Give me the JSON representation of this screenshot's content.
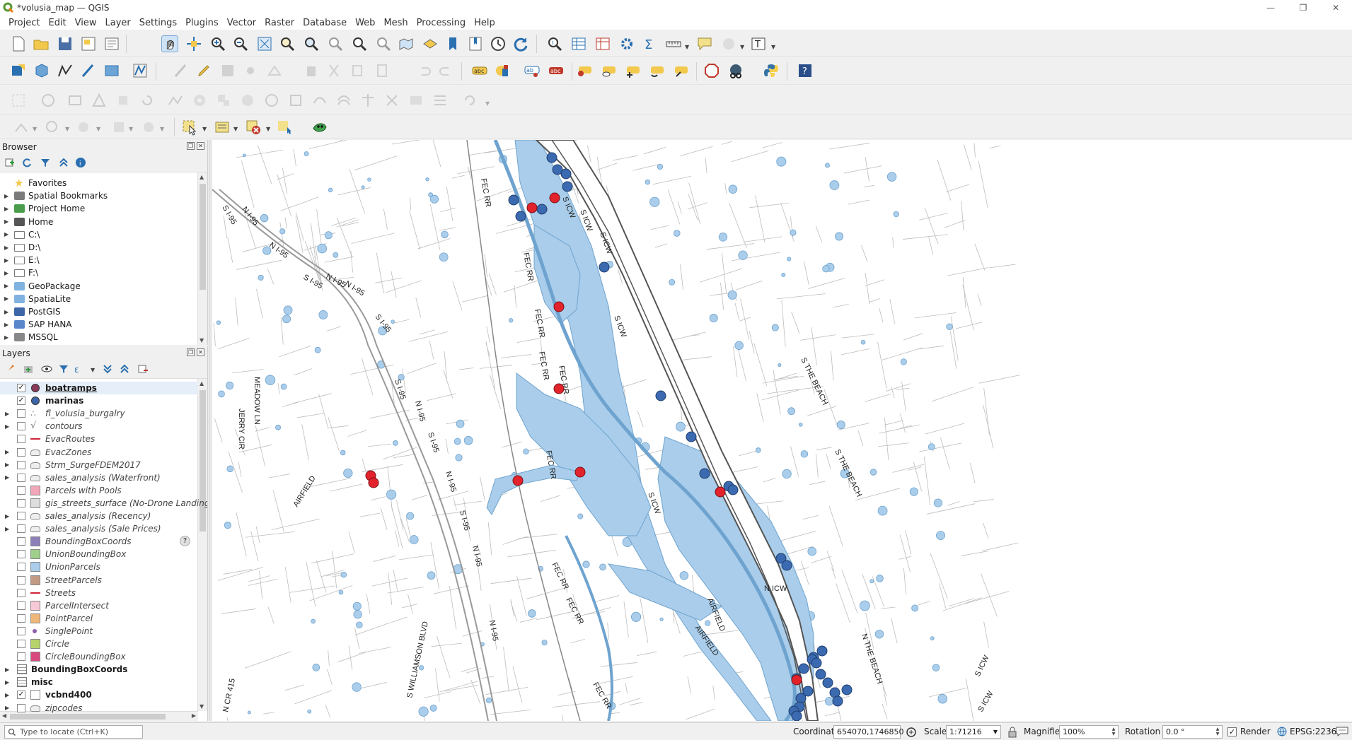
{
  "window": {
    "title": "*volusia_map — QGIS"
  },
  "menu": [
    "Project",
    "Edit",
    "View",
    "Layer",
    "Settings",
    "Plugins",
    "Vector",
    "Raster",
    "Database",
    "Web",
    "Mesh",
    "Processing",
    "Help"
  ],
  "browser": {
    "title": "Browser",
    "items": [
      {
        "label": "Favorites",
        "icon": "star-icon"
      },
      {
        "label": "Spatial Bookmarks",
        "icon": "bookmark-icon"
      },
      {
        "label": "Project Home",
        "icon": "project-home-icon"
      },
      {
        "label": "Home",
        "icon": "home-folder-icon"
      },
      {
        "label": "C:\\",
        "icon": "folder-icon"
      },
      {
        "label": "D:\\",
        "icon": "folder-icon"
      },
      {
        "label": "E:\\",
        "icon": "folder-icon"
      },
      {
        "label": "F:\\",
        "icon": "folder-icon"
      },
      {
        "label": "GeoPackage",
        "icon": "geopackage-icon"
      },
      {
        "label": "SpatiaLite",
        "icon": "spatialite-icon"
      },
      {
        "label": "PostGIS",
        "icon": "postgis-icon"
      },
      {
        "label": "SAP HANA",
        "icon": "sap-hana-icon"
      },
      {
        "label": "MSSQL",
        "icon": "mssql-icon"
      }
    ]
  },
  "layers": {
    "title": "Layers",
    "items": [
      {
        "label": "boatramps",
        "checked": true,
        "style": "bold-underline",
        "color": "#8b3a5a"
      },
      {
        "label": "marinas",
        "checked": true,
        "style": "bold",
        "color": "#3d66a8"
      },
      {
        "label": "fl_volusia_burgalry",
        "checked": false,
        "style": "italic",
        "color": "#999999"
      },
      {
        "label": "contours",
        "checked": false,
        "style": "italic",
        "color": "#777777"
      },
      {
        "label": "EvacRoutes",
        "checked": false,
        "style": "italic",
        "color": "#d0243a"
      },
      {
        "label": "EvacZones",
        "checked": false,
        "style": "italic",
        "color": "#888888"
      },
      {
        "label": "Strm_SurgeFDEM2017",
        "checked": false,
        "style": "italic",
        "color": "#888888"
      },
      {
        "label": "sales_analysis (Waterfront)",
        "checked": false,
        "style": "italic",
        "color": "#888888"
      },
      {
        "label": "Parcels with Pools",
        "checked": false,
        "style": "italic",
        "color": "#f2a7b8"
      },
      {
        "label": "gis_streets_surface (No-Drone Landing)",
        "checked": false,
        "style": "italic",
        "color": "#dddddd"
      },
      {
        "label": "sales_analysis (Recency)",
        "checked": false,
        "style": "italic",
        "color": "#888888"
      },
      {
        "label": "sales_analysis (Sale Prices)",
        "checked": false,
        "style": "italic",
        "color": "#888888"
      },
      {
        "label": "BoundingBoxCoords",
        "checked": false,
        "style": "italic",
        "color": "#8d7fb8"
      },
      {
        "label": "UnionBoundingBox",
        "checked": false,
        "style": "italic",
        "color": "#9fcf8b"
      },
      {
        "label": "UnionParcels",
        "checked": false,
        "style": "italic",
        "color": "#a9cdea"
      },
      {
        "label": "StreetParcels",
        "checked": false,
        "style": "italic",
        "color": "#c39a86"
      },
      {
        "label": "Streets",
        "checked": false,
        "style": "italic",
        "color": "#d0243a"
      },
      {
        "label": "ParcelIntersect",
        "checked": false,
        "style": "italic",
        "color": "#f7c9d6"
      },
      {
        "label": "PointParcel",
        "checked": false,
        "style": "italic",
        "color": "#f0b77a"
      },
      {
        "label": "SinglePoint",
        "checked": false,
        "style": "italic",
        "color": "#8d5fb0"
      },
      {
        "label": "Circle",
        "checked": false,
        "style": "italic",
        "color": "#b5d36a"
      },
      {
        "label": "CircleBoundingBox",
        "checked": false,
        "style": "italic",
        "color": "#d9497f"
      },
      {
        "label": "BoundingBoxCoords",
        "checked": null,
        "style": "bold",
        "color": "#777777"
      },
      {
        "label": "misc",
        "checked": null,
        "style": "bold",
        "color": "#777777"
      },
      {
        "label": "vcbnd400",
        "checked": true,
        "style": "bold",
        "color": "#ffffff"
      },
      {
        "label": "zipcodes",
        "checked": false,
        "style": "italic",
        "color": "#888888"
      }
    ],
    "help_icon": "?"
  },
  "map": {
    "road_labels": [
      "S I-95",
      "N I-95",
      "N I-95",
      "S I-95",
      "N I-95",
      "N I-95",
      "S I-95",
      "S I-95",
      "N I-95",
      "S I-95",
      "N I-95",
      "S I-95",
      "N I-95",
      "N I-95",
      "MEADOW LN",
      "JERRY CIR",
      "AIRFIELD",
      "S WILLIAMSON BLVD",
      "N CR 415",
      "FEC RR",
      "FEC RR",
      "FEC RR",
      "FEC RR",
      "FEC RR",
      "FEC RR",
      "FEC RR",
      "FEC RR",
      "FEC RR",
      "S ICW",
      "S ICW",
      "S ICW",
      "S ICW",
      "S ICW",
      "S ICW",
      "N ICW",
      "S THE BEACH",
      "S THE BEACH",
      "N THE BEACH",
      "AIRFIELD",
      "AIRFIELD",
      "S ICW"
    ],
    "colors": {
      "water": "#a9cdea",
      "boatramp": "#e3232c",
      "marina": "#3c6ab0",
      "boundary": "#555555"
    }
  },
  "status": {
    "locate_placeholder": "Type to locate (Ctrl+K)",
    "coordinate_label": "Coordinate",
    "coordinate": "654070,1746850",
    "scale_label": "Scale",
    "scale": "1:71216",
    "magnifier_label": "Magnifier",
    "magnifier": "100%",
    "rotation_label": "Rotation",
    "rotation": "0.0 °",
    "render_label": "Render",
    "crs": "EPSG:2236"
  }
}
